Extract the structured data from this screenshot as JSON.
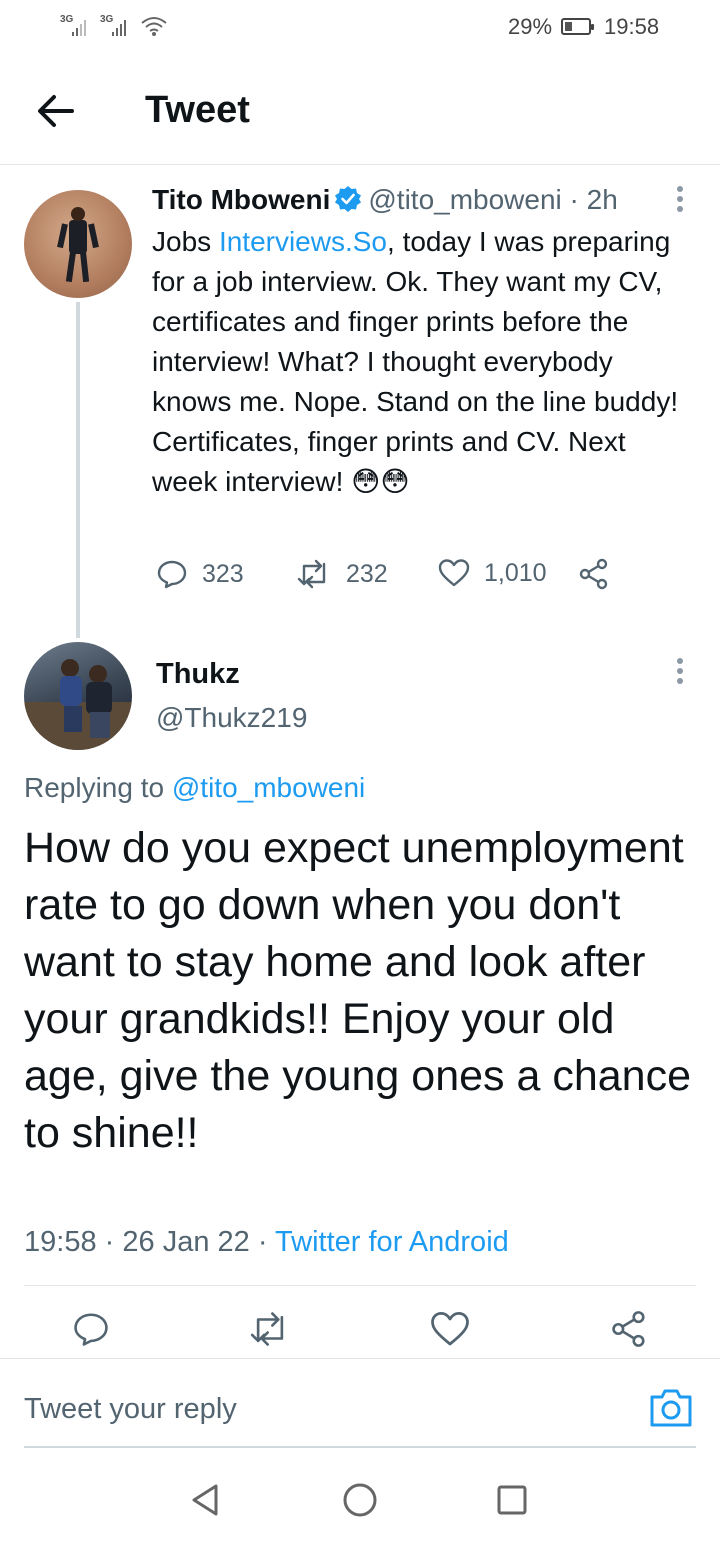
{
  "status_bar": {
    "network1": "3G",
    "network2": "3G",
    "battery_percent": "29%",
    "time": "19:58"
  },
  "header": {
    "title": "Tweet"
  },
  "parent_tweet": {
    "name": "Tito Mboweni",
    "handle": "@tito_mboweni",
    "separator": "·",
    "age": "2h",
    "text_prefix": "Jobs ",
    "text_link": "Interviews.So",
    "text_body": ", today I was preparing for a job interview. Ok. They want my CV, certificates and finger prints before the interview! What? I thought everybody knows me. Nope. Stand on the line buddy! Certificates, finger prints and CV. Next week interview! 😳😳",
    "replies": "323",
    "retweets": "232",
    "likes": "1,010"
  },
  "reply_tweet": {
    "name": "Thukz",
    "handle": "@Thukz219",
    "replying_prefix": "Replying to ",
    "replying_handle": "@tito_mboweni",
    "text": "How do you expect unemployment rate to go down when you don't want to stay home and look after your grandkids!! Enjoy your old age, give the young ones a chance to shine!!",
    "time": "19:58",
    "separator": "·",
    "date": "26 Jan 22",
    "source": "Twitter for Android"
  },
  "composer": {
    "placeholder": "Tweet your reply"
  },
  "colors": {
    "link": "#1d9bf0",
    "secondary_text": "#536471",
    "divider": "#e1e6ea"
  }
}
